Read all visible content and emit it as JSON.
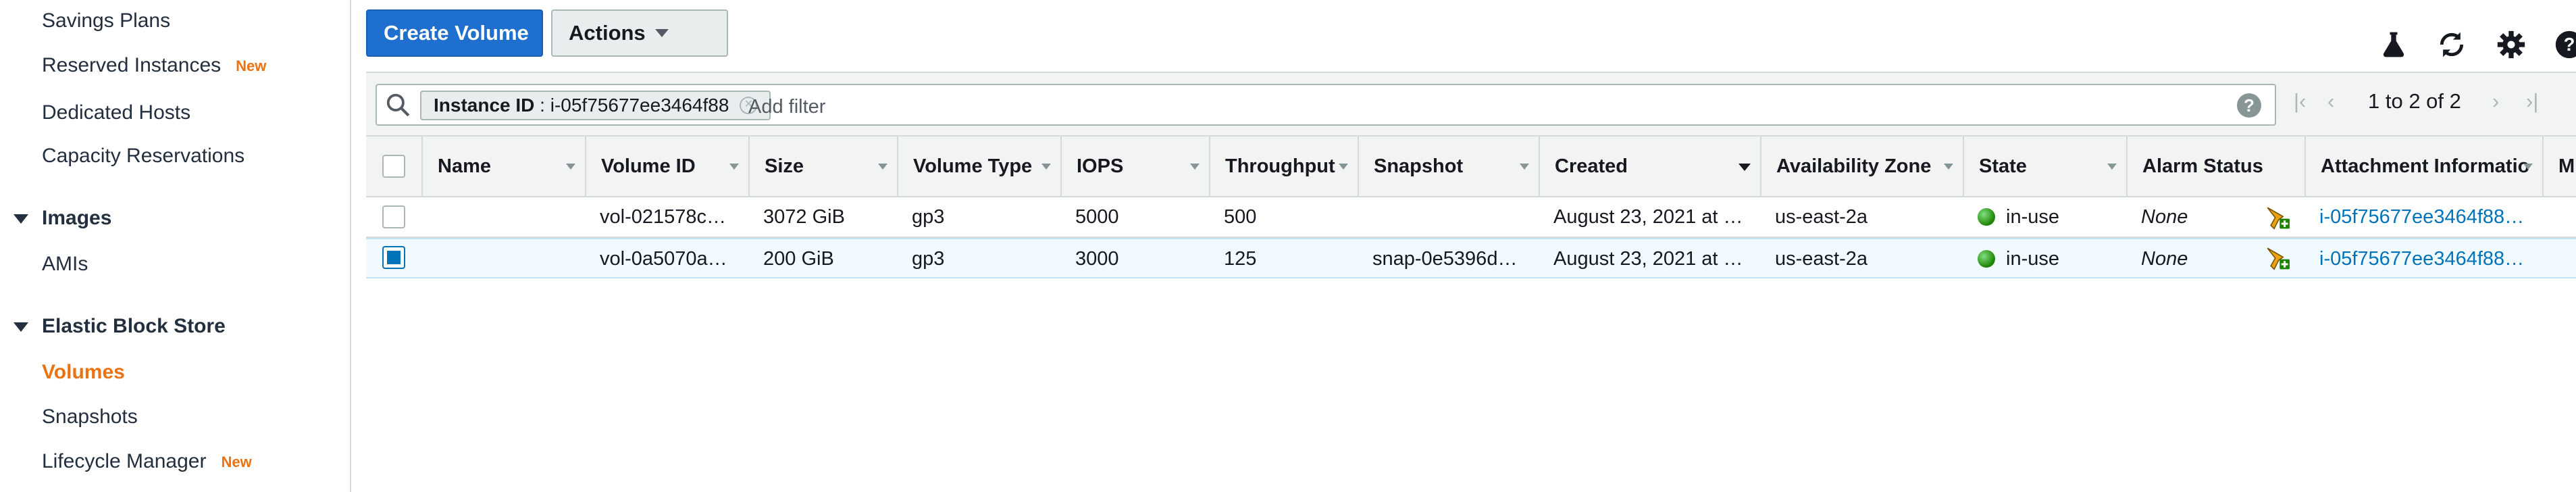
{
  "sidebar": {
    "items": [
      {
        "label": "Savings Plans"
      },
      {
        "label": "Reserved Instances",
        "badge": "New"
      },
      {
        "label": "Dedicated Hosts"
      },
      {
        "label": "Capacity Reservations"
      }
    ],
    "sections": [
      {
        "label": "Images",
        "items": [
          {
            "label": "AMIs"
          }
        ]
      },
      {
        "label": "Elastic Block Store",
        "items": [
          {
            "label": "Volumes",
            "active": true
          },
          {
            "label": "Snapshots"
          },
          {
            "label": "Lifecycle Manager",
            "badge": "New"
          }
        ]
      }
    ]
  },
  "toolbar": {
    "create_label": "Create Volume",
    "actions_label": "Actions",
    "icons": [
      "flask-icon",
      "refresh-icon",
      "gear-icon",
      "help-icon"
    ]
  },
  "filter": {
    "token_key": "Instance ID",
    "token_value": ": i-05f75677ee3464f88",
    "placeholder": "Add filter",
    "help": "?"
  },
  "pagination": {
    "range": "1 to 2 of 2"
  },
  "table": {
    "columns": [
      "Name",
      "Volume ID",
      "Size",
      "Volume Type",
      "IOPS",
      "Throughput",
      "Snapshot",
      "Created",
      "Availability Zone",
      "State",
      "Alarm Status",
      "Attachment Informatio",
      "M"
    ],
    "rows": [
      {
        "selected": false,
        "name": "",
        "volume_id": "vol-021578c…",
        "size": "3072 GiB",
        "volume_type": "gp3",
        "iops": "5000",
        "throughput": "500",
        "snapshot": "",
        "created": "August 23, 2021 at …",
        "az": "us-east-2a",
        "state": "in-use",
        "alarm_status": "None",
        "attachment": "i-05f75677ee3464f88…"
      },
      {
        "selected": true,
        "name": "",
        "volume_id": "vol-0a5070a…",
        "size": "200 GiB",
        "volume_type": "gp3",
        "iops": "3000",
        "throughput": "125",
        "snapshot": "snap-0e5396d…",
        "created": "August 23, 2021 at …",
        "az": "us-east-2a",
        "state": "in-use",
        "alarm_status": "None",
        "attachment": "i-05f75677ee3464f88…"
      }
    ]
  },
  "colors": {
    "primary": "#1f6fce",
    "active_nav": "#ec7211",
    "link": "#0073bb",
    "status_ok": "#1d8102"
  }
}
